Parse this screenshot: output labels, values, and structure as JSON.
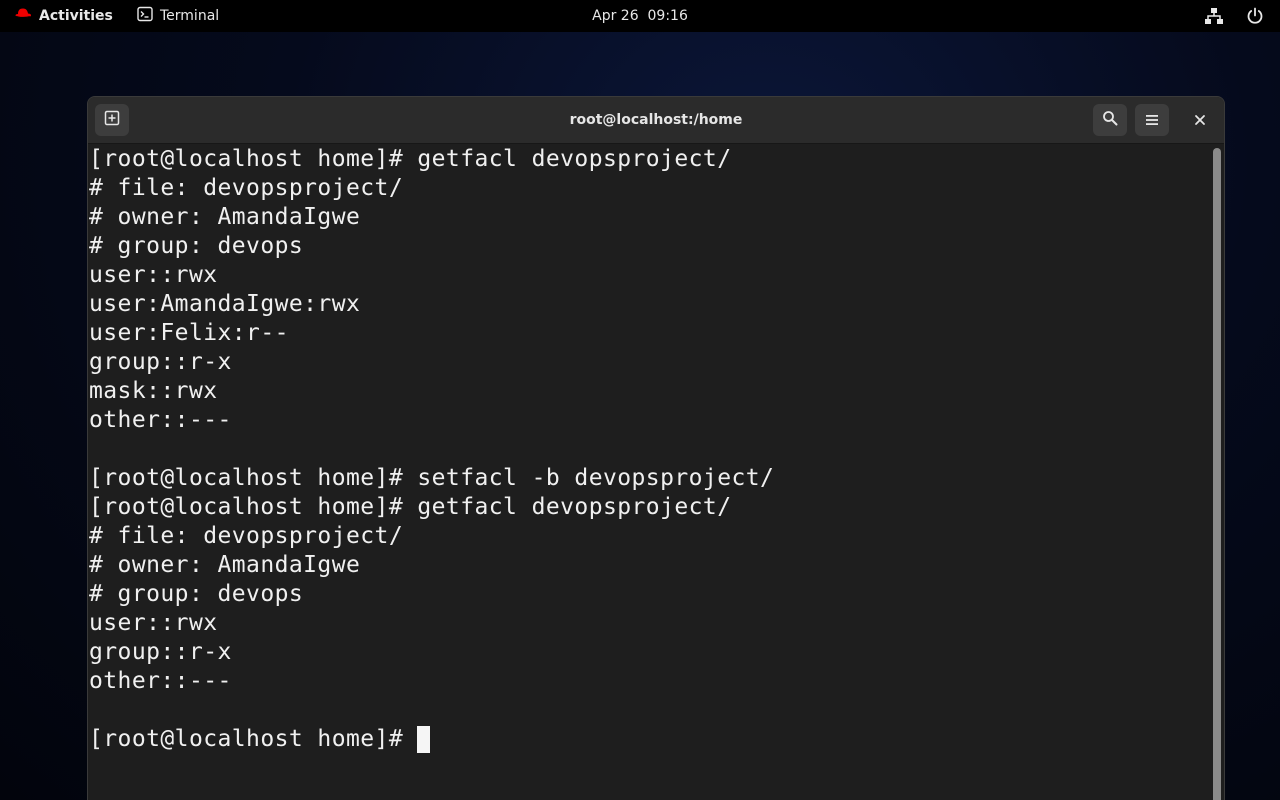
{
  "topbar": {
    "activities_label": "Activities",
    "app_name": "Terminal",
    "clock": "Apr 26  09:16"
  },
  "window": {
    "title": "root@localhost:/home"
  },
  "terminal": {
    "lines": [
      "[root@localhost home]# getfacl devopsproject/",
      "# file: devopsproject/",
      "# owner: AmandaIgwe",
      "# group: devops",
      "user::rwx",
      "user:AmandaIgwe:rwx",
      "user:Felix:r--",
      "group::r-x",
      "mask::rwx",
      "other::---",
      "",
      "[root@localhost home]# setfacl -b devopsproject/",
      "[root@localhost home]# getfacl devopsproject/",
      "# file: devopsproject/",
      "# owner: AmandaIgwe",
      "# group: devops",
      "user::rwx",
      "group::r-x",
      "other::---",
      ""
    ],
    "prompt": "[root@localhost home]# "
  },
  "icons": {
    "activities": "redhat-logo-icon",
    "app": "terminal-icon",
    "network": "network-icon",
    "power": "power-icon",
    "new_tab": "new-tab-icon",
    "search": "search-icon",
    "menu": "hamburger-menu-icon",
    "close": "close-icon"
  },
  "colors": {
    "brand_red": "#ee0000",
    "terminal_bg": "#1e1e1e",
    "terminal_fg": "#f0f0f0"
  }
}
